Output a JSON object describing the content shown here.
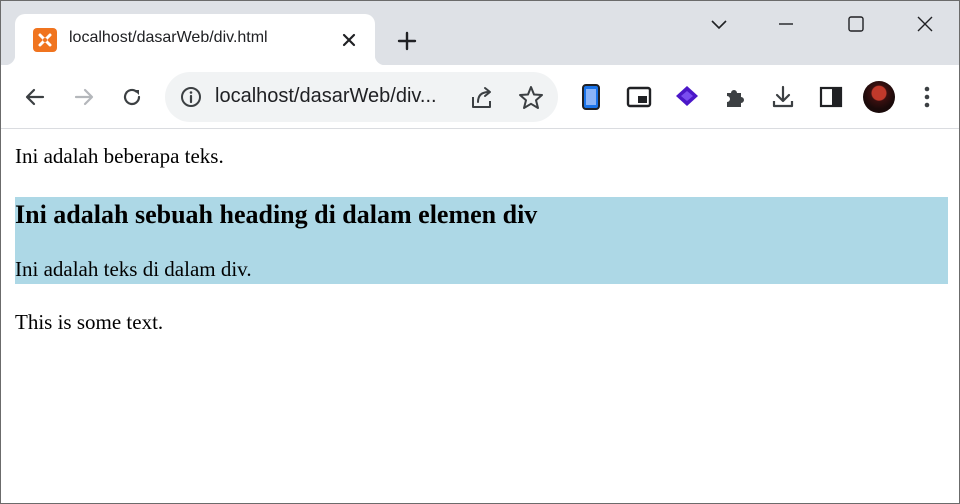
{
  "browser": {
    "tab": {
      "title": "localhost/dasarWeb/div.html"
    },
    "omnibox": {
      "url": "localhost/dasarWeb/div..."
    },
    "icons": [
      "xampp-favicon",
      "close-icon",
      "plus-icon",
      "chevron-down-icon",
      "minimize-icon",
      "maximize-icon",
      "close-window-icon",
      "back-arrow-icon",
      "forward-arrow-icon",
      "reload-icon",
      "info-icon",
      "share-icon",
      "star-icon",
      "device-icon",
      "picture-in-picture-icon",
      "layers-extension-icon",
      "puzzle-icon",
      "download-icon",
      "side-panel-icon",
      "avatar",
      "kebab-menu-icon"
    ],
    "colors": {
      "tabstrip": "#dee1e6",
      "omnibox": "#f1f3f4",
      "favicon": "#f0741f",
      "extension": "#4b17c8"
    }
  },
  "page": {
    "paragraph_1": "Ini adalah beberapa teks.",
    "div": {
      "heading": "Ini adalah sebuah heading di dalam elemen div",
      "text": "Ini adalah teks di dalam div.",
      "background": "#add8e6"
    },
    "paragraph_2": "This is some text."
  }
}
